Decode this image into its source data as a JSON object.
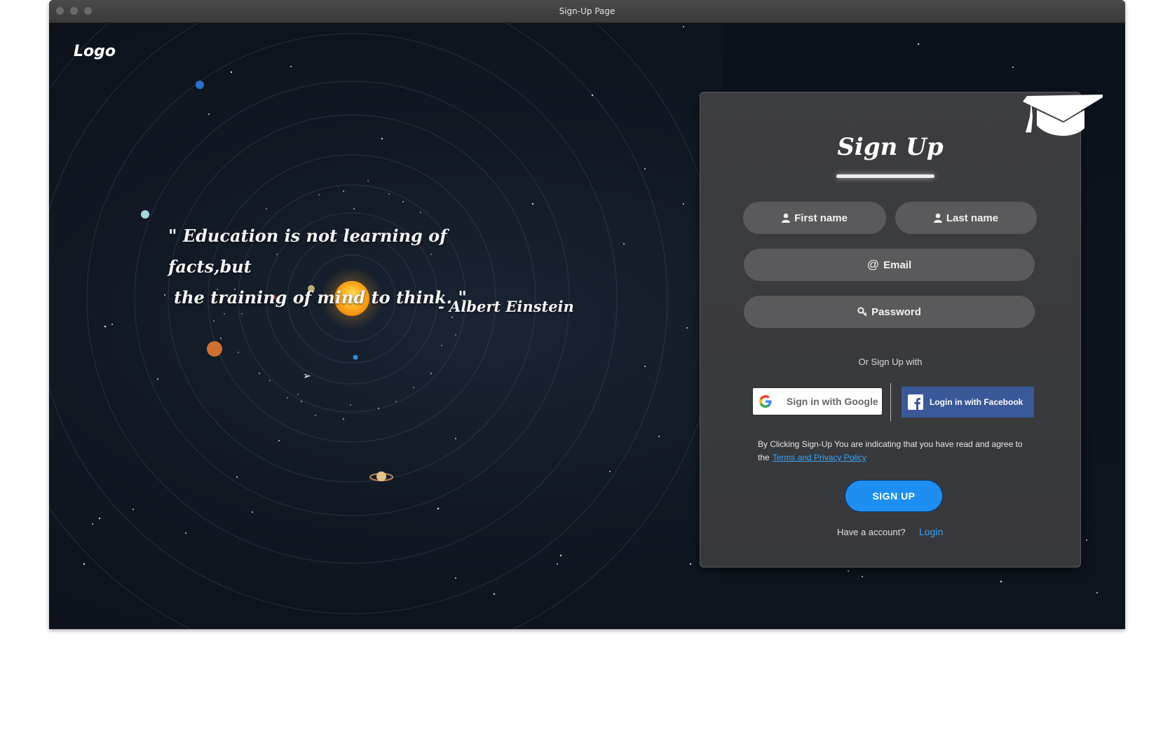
{
  "window": {
    "title": "Sign-Up Page"
  },
  "brand": {
    "logo": "Logo"
  },
  "hero": {
    "quote_line1": "\" Education is not learning of facts,but",
    "quote_line2": "the training of mind to think. \"",
    "author": "- Albert Einstein"
  },
  "form": {
    "title": "Sign Up",
    "first_name": "First name",
    "last_name": "Last name",
    "email": "Email",
    "password": "Password",
    "or_text": "Or Sign Up with",
    "google_label": "Sign in with Google",
    "facebook_label": "Login in with Facebook",
    "terms_text": "By Clicking Sign-Up You are indicating that you have read and agree to the",
    "terms_link": "Terms and Privacy Policy",
    "submit_label": "SIGN UP",
    "have_account": "Have a account?",
    "login_link": "Login"
  },
  "icons": {
    "user": "user-icon",
    "email": "at-icon",
    "password": "key-icon",
    "google": "google-icon",
    "facebook": "facebook-icon",
    "cap": "graduation-cap-icon"
  },
  "colors": {
    "accent": "#1e8ff0",
    "link": "#3aa3f5",
    "facebook": "#3b5998",
    "field": "#5a5a5c",
    "card": "#3c3d40"
  }
}
